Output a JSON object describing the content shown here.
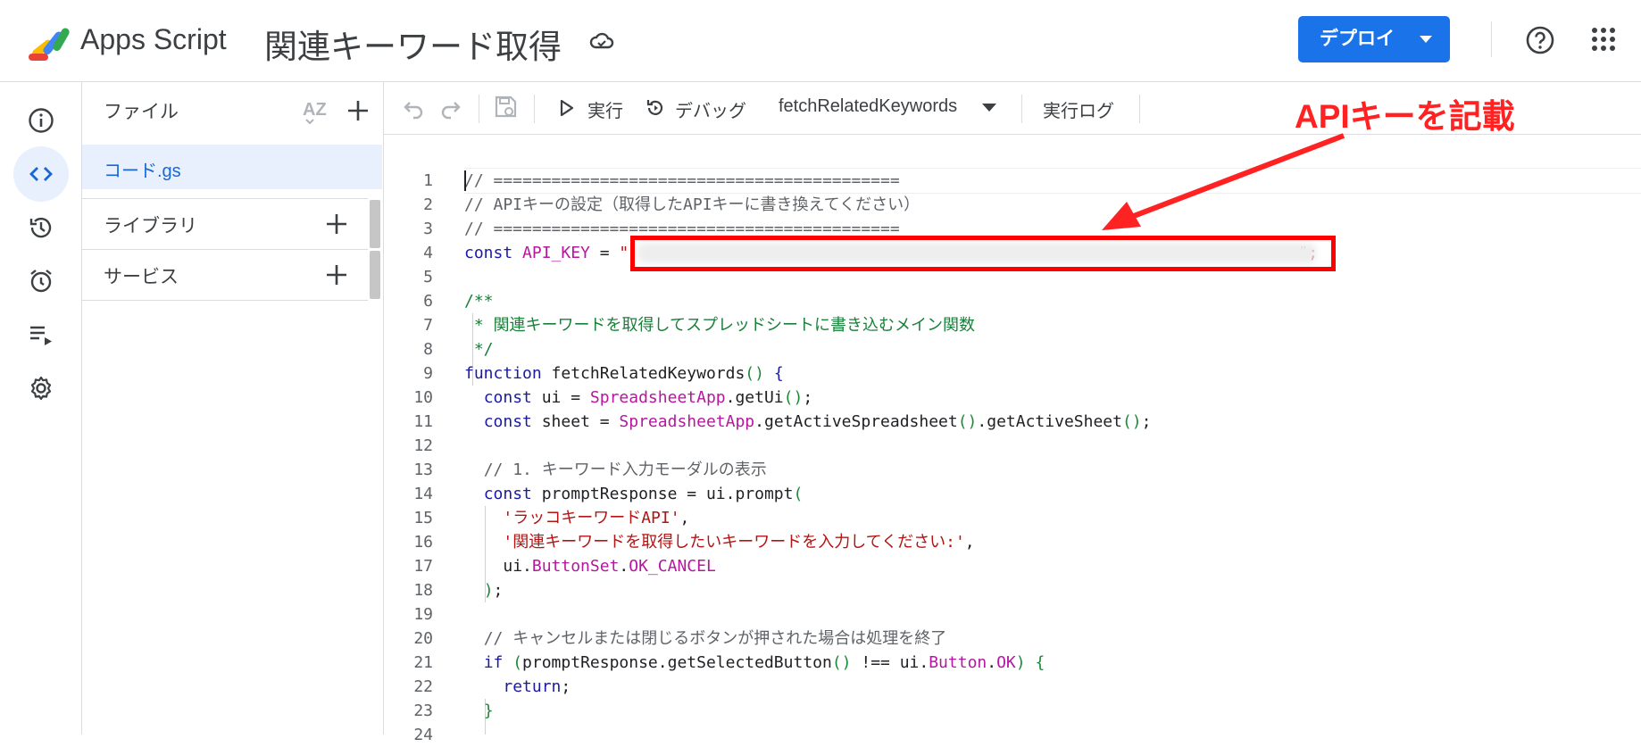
{
  "header": {
    "app_name": "Apps Script",
    "project_title": "関連キーワード取得",
    "deploy_label": "デプロイ"
  },
  "files_panel": {
    "title": "ファイル",
    "file_name": "コード.gs",
    "libraries_label": "ライブラリ",
    "services_label": "サービス"
  },
  "toolbar": {
    "run_label": "実行",
    "debug_label": "デバッグ",
    "function_select": "fetchRelatedKeywords",
    "log_label": "実行ログ"
  },
  "annotation": {
    "label": "APIキーを記載"
  },
  "editor": {
    "line_numbers": [
      "1",
      "2",
      "3",
      "4",
      "5",
      "6",
      "7",
      "8",
      "9",
      "10",
      "11",
      "12",
      "13",
      "14",
      "15",
      "16",
      "17",
      "18",
      "19",
      "20",
      "21",
      "22",
      "23",
      "24"
    ],
    "code": {
      "l1": "// ==========================================",
      "l2": "// APIキーの設定（取得したAPIキーに書き換えてください）",
      "l3": "// ==========================================",
      "l4_kw": "const ",
      "l4_name": "API_KEY",
      "l4_eq": " = ",
      "l4_q1": "\"",
      "l4_end": "\";",
      "l6": "/**",
      "l7": " * 関連キーワードを取得してスプレッドシートに書き込むメイン関数",
      "l8": " */",
      "l9_kw": "function ",
      "l9_name": "fetchRelatedKeywords",
      "l9_p": "()",
      "l9_b": " {",
      "l10_kw": "const ",
      "l10_a": "ui = ",
      "l10_t": "SpreadsheetApp",
      "l10_b": ".getUi",
      "l10_p": "()",
      "l10_s": ";",
      "l11_kw": "const ",
      "l11_a": "sheet = ",
      "l11_t": "SpreadsheetApp",
      "l11_b": ".getActiveSpreadsheet",
      "l11_p1": "()",
      "l11_c": ".getActiveSheet",
      "l11_p2": "()",
      "l11_s": ";",
      "l13": "// 1. キーワード入力モーダルの表示",
      "l14_kw": "const ",
      "l14_a": "promptResponse = ui.prompt",
      "l14_p": "(",
      "l15_s": "'ラッコキーワードAPI'",
      "l15_c": ",",
      "l16_s": "'関連キーワードを取得したいキーワードを入力してください:'",
      "l16_c": ",",
      "l17_a": "ui.",
      "l17_t1": "ButtonSet",
      "l17_d": ".",
      "l17_t2": "OK_CANCEL",
      "l18_p": ")",
      "l18_s": ";",
      "l20": "// キャンセルまたは閉じるボタンが押された場合は処理を終了",
      "l21_kw": "if ",
      "l21_p1": "(",
      "l21_a": "promptResponse.getSelectedButton",
      "l21_p2": "()",
      "l21_b": " !== ui.",
      "l21_t1": "Button",
      "l21_d": ".",
      "l21_t2": "OK",
      "l21_p3": ")",
      "l21_br": " {",
      "l22_kw": "return",
      "l22_s": ";",
      "l23": "}"
    }
  }
}
